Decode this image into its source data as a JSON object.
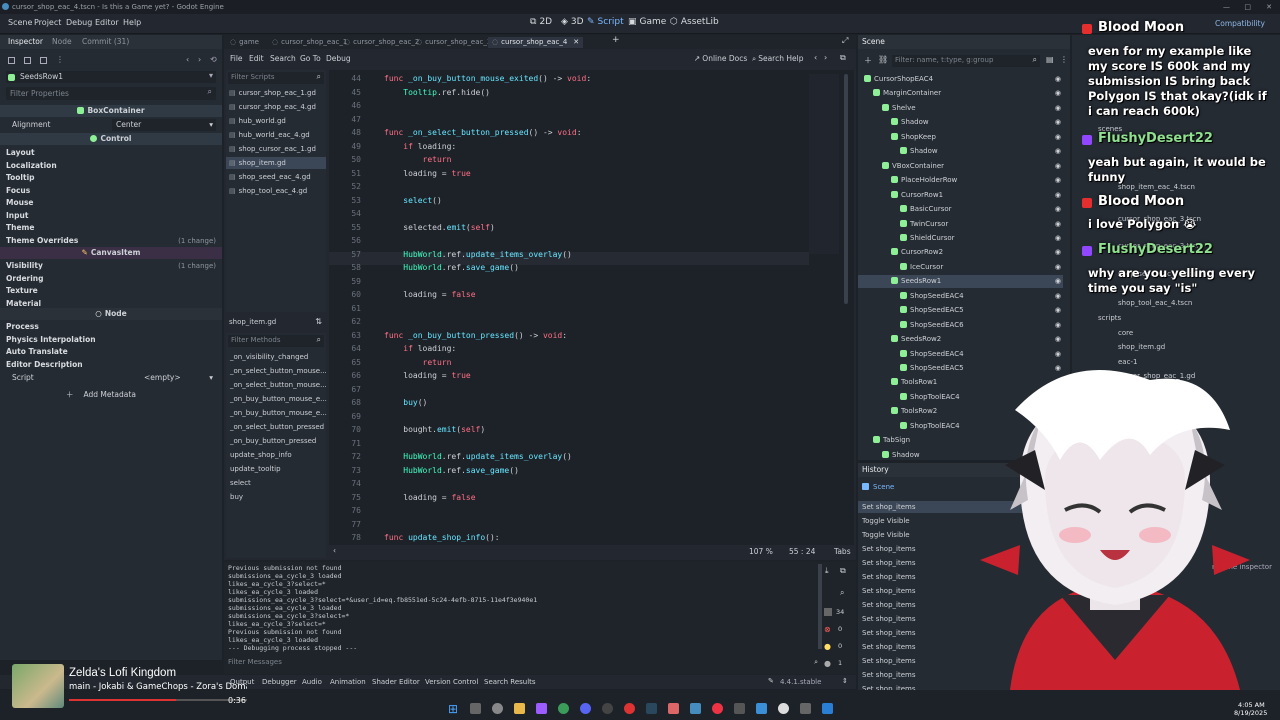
{
  "window": {
    "title": "cursor_shop_eac_4.tscn - Is this a Game yet? - Godot Engine",
    "min": "—",
    "max": "□",
    "close": "✕"
  },
  "menu": [
    "Scene",
    "Project",
    "Debug",
    "Editor",
    "Help"
  ],
  "workspaces": [
    {
      "icon": "2d-icon",
      "label": "2D"
    },
    {
      "icon": "3d-icon",
      "label": "3D"
    },
    {
      "icon": "script-icon",
      "label": "Script"
    },
    {
      "icon": "game-icon",
      "label": "Game"
    },
    {
      "icon": "assetlib-icon",
      "label": "AssetLib"
    }
  ],
  "renderer": "Compatibility",
  "inspector": {
    "tabs": [
      "Inspector",
      "Node",
      "Commit (31)"
    ],
    "node_name": "SeedsRow1",
    "filter_placeholder": "Filter Properties",
    "class1": "BoxContainer",
    "alignment_label": "Alignment",
    "alignment_value": "Center",
    "class2": "Control",
    "control_sections": [
      {
        "label": "Layout",
        "note": ""
      },
      {
        "label": "Localization",
        "note": ""
      },
      {
        "label": "Tooltip",
        "note": ""
      },
      {
        "label": "Focus",
        "note": ""
      },
      {
        "label": "Mouse",
        "note": ""
      },
      {
        "label": "Input",
        "note": ""
      },
      {
        "label": "Theme",
        "note": ""
      },
      {
        "label": "Theme Overrides",
        "note": "(1 change)"
      }
    ],
    "class3": "CanvasItem",
    "canvas_sections": [
      {
        "label": "Visibility",
        "note": "(1 change)"
      },
      {
        "label": "Ordering",
        "note": ""
      },
      {
        "label": "Texture",
        "note": ""
      },
      {
        "label": "Material",
        "note": ""
      }
    ],
    "class4": "Node",
    "node_sections": [
      "Process",
      "Physics Interpolation",
      "Auto Translate",
      "Editor Description"
    ],
    "script_label": "Script",
    "script_value": "<empty>",
    "add_metadata": "Add Metadata"
  },
  "script_editor": {
    "tabs": [
      "game",
      "cursor_shop_eac_1",
      "cursor_shop_eac_2",
      "cursor_shop_eac_3",
      "cursor_shop_eac_4"
    ],
    "menu": [
      "File",
      "Edit",
      "Search",
      "Go To",
      "Debug"
    ],
    "online_docs": "Online Docs",
    "search_help": "Search Help",
    "filter_scripts": "Filter Scripts",
    "scripts": [
      "cursor_shop_eac_1.gd",
      "cursor_shop_eac_4.gd",
      "hub_world.gd",
      "hub_world_eac_4.gd",
      "shop_cursor_eac_1.gd",
      "shop_item.gd",
      "shop_seed_eac_4.gd",
      "shop_tool_eac_4.gd"
    ],
    "selected_script": 5,
    "current_file": "shop_item.gd",
    "filter_methods": "Filter Methods",
    "methods": [
      "_on_visibility_changed",
      "_on_select_button_mouse...",
      "_on_select_button_mouse...",
      "_on_buy_button_mouse_e...",
      "_on_buy_button_mouse_e...",
      "_on_select_button_pressed",
      "_on_buy_button_pressed",
      "update_shop_info",
      "update_tooltip",
      "select",
      "buy"
    ],
    "lines": [
      {
        "n": "44",
        "t": [
          [
            "kw",
            "func "
          ],
          [
            "fn",
            "_on_buy_button_mouse_exited"
          ],
          [
            "",
            "() -> "
          ],
          [
            "kw",
            "void"
          ],
          [
            "",
            ":"
          ]
        ]
      },
      {
        "n": "45",
        "t": [
          [
            "",
            "    "
          ],
          [
            "ty",
            "Tooltip"
          ],
          [
            "",
            ".ref.hide()"
          ]
        ]
      },
      {
        "n": "46",
        "t": []
      },
      {
        "n": "47",
        "t": []
      },
      {
        "n": "48",
        "t": [
          [
            "kw",
            "func "
          ],
          [
            "fn",
            "_on_select_button_pressed"
          ],
          [
            "",
            "() -> "
          ],
          [
            "kw",
            "void"
          ],
          [
            "",
            ":"
          ]
        ]
      },
      {
        "n": "49",
        "t": [
          [
            "",
            "    "
          ],
          [
            "kw",
            "if "
          ],
          [
            "",
            "loading:"
          ]
        ]
      },
      {
        "n": "50",
        "t": [
          [
            "",
            "        "
          ],
          [
            "kw",
            "return"
          ]
        ]
      },
      {
        "n": "51",
        "t": [
          [
            "",
            "    loading = "
          ],
          [
            "kw",
            "true"
          ]
        ]
      },
      {
        "n": "52",
        "t": []
      },
      {
        "n": "53",
        "t": [
          [
            "",
            "    "
          ],
          [
            "fn",
            "select"
          ],
          [
            "",
            "()"
          ]
        ]
      },
      {
        "n": "54",
        "t": []
      },
      {
        "n": "55",
        "t": [
          [
            "",
            "    selected."
          ],
          [
            "fn",
            "emit"
          ],
          [
            "",
            "("
          ],
          [
            "kw",
            "self"
          ],
          [
            "",
            ")"
          ]
        ]
      },
      {
        "n": "56",
        "t": []
      },
      {
        "n": "57",
        "t": [
          [
            "",
            "    "
          ],
          [
            "ty",
            "HubWorld"
          ],
          [
            "",
            ".ref."
          ],
          [
            "fn",
            "update_items_overlay"
          ],
          [
            "",
            "()"
          ]
        ]
      },
      {
        "n": "58",
        "t": [
          [
            "",
            "    "
          ],
          [
            "ty",
            "HubWorld"
          ],
          [
            "",
            ".ref."
          ],
          [
            "fn",
            "save_game"
          ],
          [
            "",
            "()"
          ]
        ]
      },
      {
        "n": "59",
        "t": []
      },
      {
        "n": "60",
        "t": [
          [
            "",
            "    loading = "
          ],
          [
            "kw",
            "false"
          ]
        ]
      },
      {
        "n": "61",
        "t": []
      },
      {
        "n": "62",
        "t": []
      },
      {
        "n": "63",
        "t": [
          [
            "kw",
            "func "
          ],
          [
            "fn",
            "_on_buy_button_pressed"
          ],
          [
            "",
            "() -> "
          ],
          [
            "kw",
            "void"
          ],
          [
            "",
            ":"
          ]
        ]
      },
      {
        "n": "64",
        "t": [
          [
            "",
            "    "
          ],
          [
            "kw",
            "if "
          ],
          [
            "",
            "loading:"
          ]
        ]
      },
      {
        "n": "65",
        "t": [
          [
            "",
            "        "
          ],
          [
            "kw",
            "return"
          ]
        ]
      },
      {
        "n": "66",
        "t": [
          [
            "",
            "    loading = "
          ],
          [
            "kw",
            "true"
          ]
        ]
      },
      {
        "n": "67",
        "t": []
      },
      {
        "n": "68",
        "t": [
          [
            "",
            "    "
          ],
          [
            "fn",
            "buy"
          ],
          [
            "",
            "()"
          ]
        ]
      },
      {
        "n": "69",
        "t": []
      },
      {
        "n": "70",
        "t": [
          [
            "",
            "    bought."
          ],
          [
            "fn",
            "emit"
          ],
          [
            "",
            "("
          ],
          [
            "kw",
            "self"
          ],
          [
            "",
            ")"
          ]
        ]
      },
      {
        "n": "71",
        "t": []
      },
      {
        "n": "72",
        "t": [
          [
            "",
            "    "
          ],
          [
            "ty",
            "HubWorld"
          ],
          [
            "",
            ".ref."
          ],
          [
            "fn",
            "update_items_overlay"
          ],
          [
            "",
            "()"
          ]
        ]
      },
      {
        "n": "73",
        "t": [
          [
            "",
            "    "
          ],
          [
            "ty",
            "HubWorld"
          ],
          [
            "",
            ".ref."
          ],
          [
            "fn",
            "save_game"
          ],
          [
            "",
            "()"
          ]
        ]
      },
      {
        "n": "74",
        "t": []
      },
      {
        "n": "75",
        "t": [
          [
            "",
            "    loading = "
          ],
          [
            "kw",
            "false"
          ]
        ]
      },
      {
        "n": "76",
        "t": []
      },
      {
        "n": "77",
        "t": []
      },
      {
        "n": "78",
        "t": [
          [
            "kw",
            "func "
          ],
          [
            "fn",
            "update_shop_info"
          ],
          [
            "",
            "():"
          ]
        ]
      }
    ],
    "zoom": "107 %",
    "cursor_pos": "55 :   24",
    "indent": "Tabs"
  },
  "output": {
    "lines": [
      "Previous submission not found",
      "submissions_ea_cycle_3 loaded",
      "likes_ea_cycle_3?select=*",
      "likes_ea_cycle_3 loaded",
      "submissions_ea_cycle_3?select=*&user_id=eq.fb8551ed-5c24-4efb-8715-11e4f3e940e1",
      "submissions_ea_cycle_3 loaded",
      "submissions_ea_cycle_3?select=*",
      "likes_ea_cycle_3?select=*",
      "Previous submission not found",
      "likes_ea_cycle_3 loaded",
      "--- Debugging process stopped ---"
    ],
    "filter": "Filter Messages",
    "counts": [
      "34",
      "0",
      "0",
      "1"
    ],
    "bottom_tabs": [
      "Output",
      "Debugger",
      "Audio",
      "Animation",
      "Shader Editor",
      "Version Control",
      "Search Results"
    ],
    "version": "4.4.1.stable"
  },
  "scene": {
    "tab": "Scene",
    "filter": "Filter: name, t:type, g:group",
    "nodes": [
      {
        "d": 0,
        "name": "CursorShopEAC4",
        "c": "#8eef97"
      },
      {
        "d": 1,
        "name": "MarginContainer",
        "c": "#8eef97"
      },
      {
        "d": 2,
        "name": "Shelve",
        "c": "#8eef97"
      },
      {
        "d": 3,
        "name": "Shadow",
        "c": "#8eef97"
      },
      {
        "d": 3,
        "name": "ShopKeep",
        "c": "#8eef97"
      },
      {
        "d": 4,
        "name": "Shadow",
        "c": "#8eef97"
      },
      {
        "d": 2,
        "name": "VBoxContainer",
        "c": "#8eef97"
      },
      {
        "d": 3,
        "name": "PlaceHolderRow",
        "c": "#8eef97"
      },
      {
        "d": 3,
        "name": "CursorRow1",
        "c": "#8eef97"
      },
      {
        "d": 4,
        "name": "BasicCursor",
        "c": "#8eef97"
      },
      {
        "d": 4,
        "name": "TwinCursor",
        "c": "#8eef97"
      },
      {
        "d": 4,
        "name": "ShieldCursor",
        "c": "#8eef97"
      },
      {
        "d": 3,
        "name": "CursorRow2",
        "c": "#8eef97"
      },
      {
        "d": 4,
        "name": "IceCursor",
        "c": "#8eef97"
      },
      {
        "d": 3,
        "name": "SeedsRow1",
        "c": "#8eef97"
      },
      {
        "d": 4,
        "name": "ShopSeedEAC4",
        "c": "#8eef97"
      },
      {
        "d": 4,
        "name": "ShopSeedEAC5",
        "c": "#8eef97"
      },
      {
        "d": 4,
        "name": "ShopSeedEAC6",
        "c": "#8eef97"
      },
      {
        "d": 3,
        "name": "SeedsRow2",
        "c": "#8eef97"
      },
      {
        "d": 4,
        "name": "ShopSeedEAC4",
        "c": "#8eef97"
      },
      {
        "d": 4,
        "name": "ShopSeedEAC5",
        "c": "#8eef97"
      },
      {
        "d": 3,
        "name": "ToolsRow1",
        "c": "#8eef97"
      },
      {
        "d": 4,
        "name": "ShopToolEAC4",
        "c": "#8eef97"
      },
      {
        "d": 3,
        "name": "ToolsRow2",
        "c": "#8eef97"
      },
      {
        "d": 4,
        "name": "ShopToolEAC4",
        "c": "#8eef97"
      },
      {
        "d": 1,
        "name": "TabSign",
        "c": "#8eef97"
      },
      {
        "d": 2,
        "name": "Shadow",
        "c": "#8eef97"
      }
    ],
    "selected": 14
  },
  "history": {
    "tab": "History",
    "scene_label": "Scene",
    "items": [
      "Set shop_items",
      "Toggle Visible",
      "Toggle Visible",
      "Set shop_items",
      "Set shop_items",
      "Set shop_items",
      "Set shop_items",
      "Set shop_items",
      "Set shop_items",
      "Set shop_items",
      "Set shop_items",
      "Set shop_items",
      "Set shop_items",
      "Set shop_items"
    ]
  },
  "filesystem": {
    "items": [
      "scenes",
      "shop_item_eac_4.tscn",
      "cursor_shop_eac_3.tscn",
      "cursor_shop_eac_3.tscn",
      "shop_seed_eac_4.tscn",
      "shop_tool_eac_4.tscn",
      "scripts",
      "core",
      "shop_item.gd",
      "eac-1",
      "cursor_shop_eac_1.gd",
      "shop_cursor_eac_1.gd",
      "eac_4.gd",
      "eac_4.gd"
    ],
    "hint": "r in the inspector"
  },
  "chat": [
    {
      "name": "Blood Moon",
      "name_color": "#ffffff",
      "msg": "even for my example like my score IS 600k and my submission IS bring back Polygon IS that okay?(idk if i can reach 600k)"
    },
    {
      "name": "FlushyDesert22",
      "name_color": "#8fe08f",
      "msg": "yeah but again, it would be funny"
    },
    {
      "name": "Blood Moon",
      "name_color": "#ffffff",
      "msg": "i love Polygon 😭"
    },
    {
      "name": "FlushyDesert22",
      "name_color": "#8fe08f",
      "msg": "why are you yelling every time you say \"is\""
    }
  ],
  "music": {
    "title": "Zelda's Lofi Kingdom",
    "artist": "main - Jokabi & GameChops - Zora's Domain -",
    "time": "0:36",
    "progress": 0.6
  },
  "clock": {
    "time": "4:05 AM",
    "date": "8/19/2025"
  },
  "colors": {
    "accent": "#79b7ff",
    "keyword": "#ff7085",
    "function": "#66e6ff",
    "type": "#42ffc2",
    "node": "#8eef97"
  }
}
